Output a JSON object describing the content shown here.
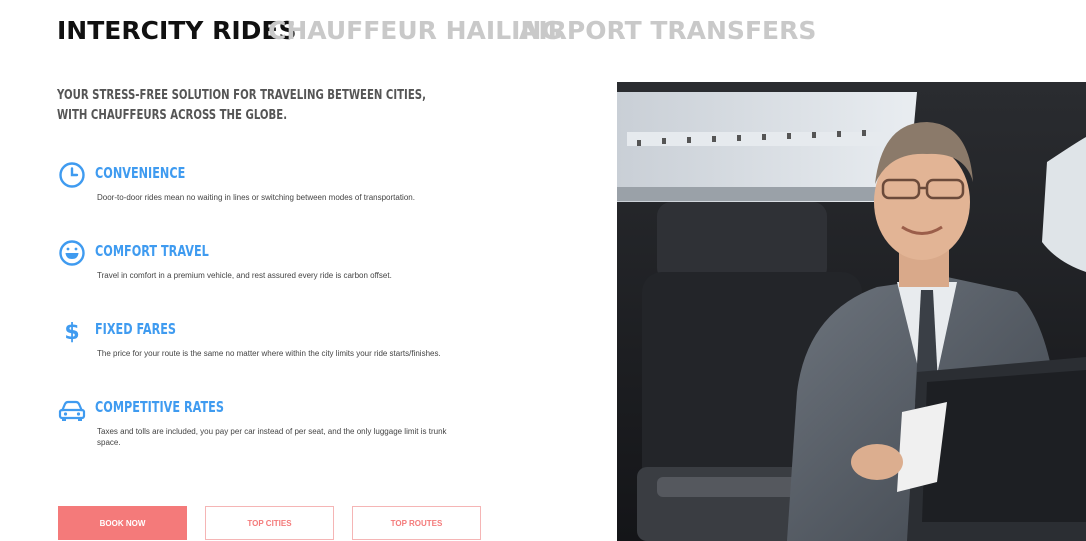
{
  "tabs": [
    {
      "label": "INTERCITY RIDES",
      "active": true
    },
    {
      "label": "CHAUFFEUR HAILING",
      "active": false
    },
    {
      "label": "AIRPORT TRANSFERS",
      "active": false
    }
  ],
  "intro": {
    "line1": "YOUR STRESS-FREE SOLUTION FOR TRAVELING BETWEEN CITIES,",
    "line2": "WITH CHAUFFEURS ACROSS THE GLOBE."
  },
  "features": [
    {
      "icon": "clock-icon",
      "title": "CONVENIENCE",
      "desc": "Door-to-door rides mean no waiting in lines or switching between modes of transportation."
    },
    {
      "icon": "smile-icon",
      "title": "COMFORT TRAVEL",
      "desc": "Travel in comfort in a premium vehicle, and rest assured every ride is carbon offset."
    },
    {
      "icon": "dollar-icon",
      "title": "FIXED FARES",
      "desc": "The price for your route is the same no matter where within the city limits your ride starts/finishes."
    },
    {
      "icon": "car-icon",
      "title": "COMPETITIVE RATES",
      "desc": "Taxes and tolls are included, you pay per car instead of per seat, and the only luggage limit is trunk space."
    }
  ],
  "buttons": {
    "primary": "BOOK NOW",
    "cities": "TOP CITIES",
    "routes": "TOP ROUTES"
  },
  "colors": {
    "accent_blue": "#3f9bf0",
    "accent_red": "#f47a7a",
    "tab_inactive": "#c9c9c9"
  }
}
